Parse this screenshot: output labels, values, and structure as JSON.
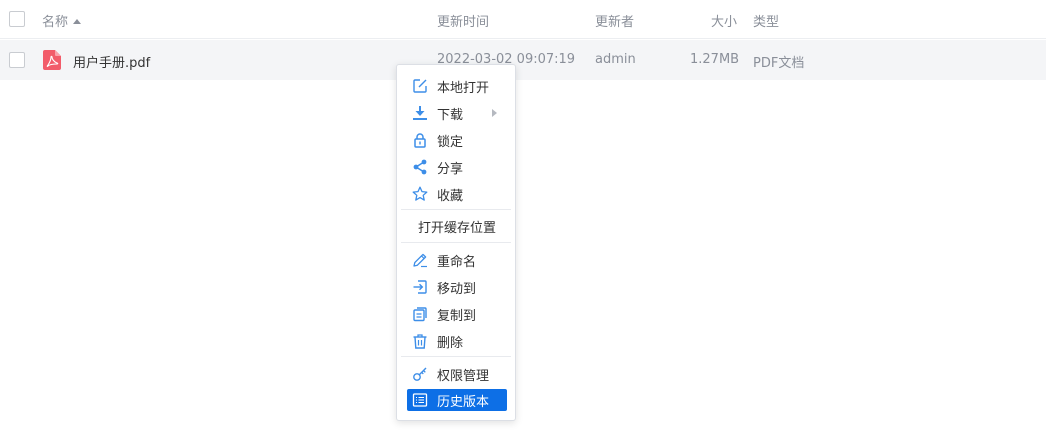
{
  "header": {
    "name": "名称",
    "updated_time": "更新时间",
    "updater": "更新者",
    "size": "大小",
    "type": "类型"
  },
  "files": [
    {
      "name": "用户手册.pdf",
      "updated_time": "2022-03-02 09:07:19",
      "updater": "admin",
      "size": "1.27MB",
      "type": "PDF文档"
    }
  ],
  "context_menu": {
    "items": [
      {
        "label": "本地打开",
        "icon": "edit-open-icon"
      },
      {
        "label": "下载",
        "icon": "download-icon",
        "submenu": true
      },
      {
        "label": "锁定",
        "icon": "lock-icon"
      },
      {
        "label": "分享",
        "icon": "share-icon"
      },
      {
        "label": "收藏",
        "icon": "star-icon"
      },
      {
        "label": "打开缓存位置"
      },
      {
        "label": "重命名",
        "icon": "pencil-icon"
      },
      {
        "label": "移动到",
        "icon": "move-to-icon"
      },
      {
        "label": "复制到",
        "icon": "copy-icon"
      },
      {
        "label": "删除",
        "icon": "trash-icon"
      },
      {
        "label": "权限管理",
        "icon": "key-icon"
      },
      {
        "label": "历史版本",
        "icon": "history-version-icon",
        "selected": true
      }
    ]
  },
  "colors": {
    "accent": "#0d6fe6",
    "icon_blue": "#3d8ee8",
    "pdf_red": "#f25c6a"
  }
}
